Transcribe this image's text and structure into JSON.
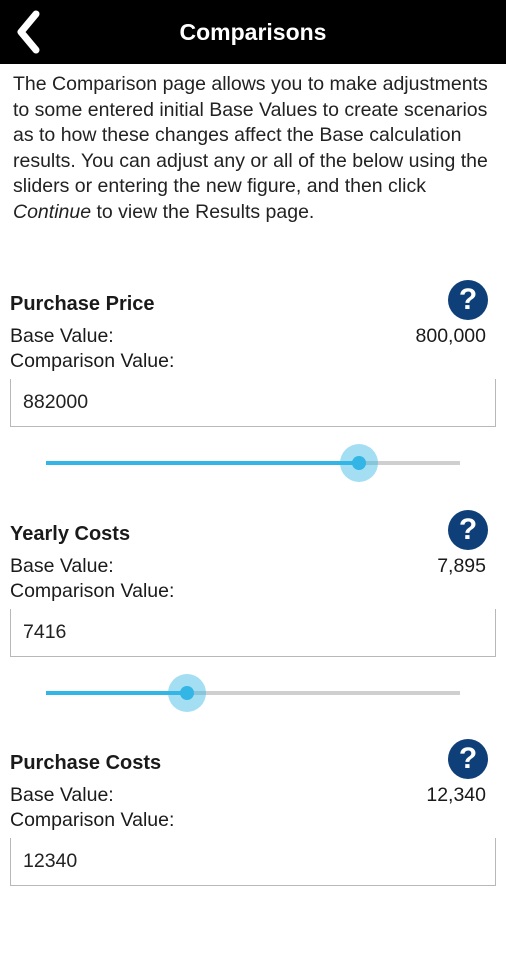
{
  "header": {
    "title": "Comparisons",
    "back_icon": "chevron-left-icon"
  },
  "intro": {
    "part1": "The Comparison page allows you to make adjustments to some entered initial Base Values to create scenarios as to how these changes affect the Base calculation results. You can adjust any or all of the below using the sliders or entering the new figure, and then click ",
    "emphasis": "Continue",
    "part2": " to view the Results page."
  },
  "accent_color": "#33b5e5",
  "help_color": "#0e3f78",
  "sections": [
    {
      "title": "Purchase Price",
      "help_label": "?",
      "base_label": "Base Value:",
      "base_value": "800,000",
      "comparison_label": "Comparison Value:",
      "comparison_value": "882000",
      "slider_fraction": 0.755
    },
    {
      "title": "Yearly Costs",
      "help_label": "?",
      "base_label": "Base Value:",
      "base_value": "7,895",
      "comparison_label": "Comparison Value:",
      "comparison_value": "7416",
      "slider_fraction": 0.34
    },
    {
      "title": "Purchase Costs",
      "help_label": "?",
      "base_label": "Base Value:",
      "base_value": "12,340",
      "comparison_label": "Comparison Value:",
      "comparison_value": "12340"
    }
  ]
}
